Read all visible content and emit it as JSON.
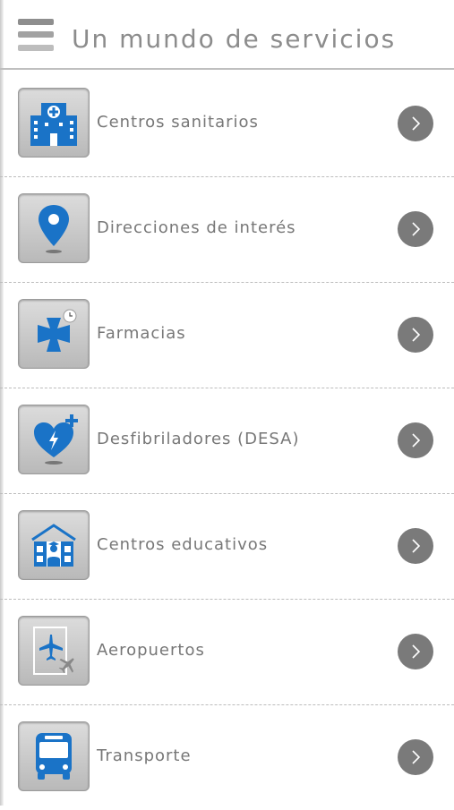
{
  "header": {
    "title": "Un mundo de servicios",
    "menu_icon": "hamburger-menu-icon"
  },
  "colors": {
    "accent": "#1a73c7",
    "tile": "#c8c8c8",
    "chevron": "#7a7a7a",
    "text": "#777777"
  },
  "items": [
    {
      "label": "Centros sanitarios",
      "icon": "hospital-icon"
    },
    {
      "label": "Direcciones de interés",
      "icon": "location-pin-icon"
    },
    {
      "label": "Farmacias",
      "icon": "pharmacy-cross-icon"
    },
    {
      "label": "Desfibriladores (DESA)",
      "icon": "defibrillator-heart-icon"
    },
    {
      "label": "Centros educativos",
      "icon": "school-icon"
    },
    {
      "label": "Aeropuertos",
      "icon": "airplane-icon"
    },
    {
      "label": "Transporte",
      "icon": "bus-icon"
    }
  ]
}
